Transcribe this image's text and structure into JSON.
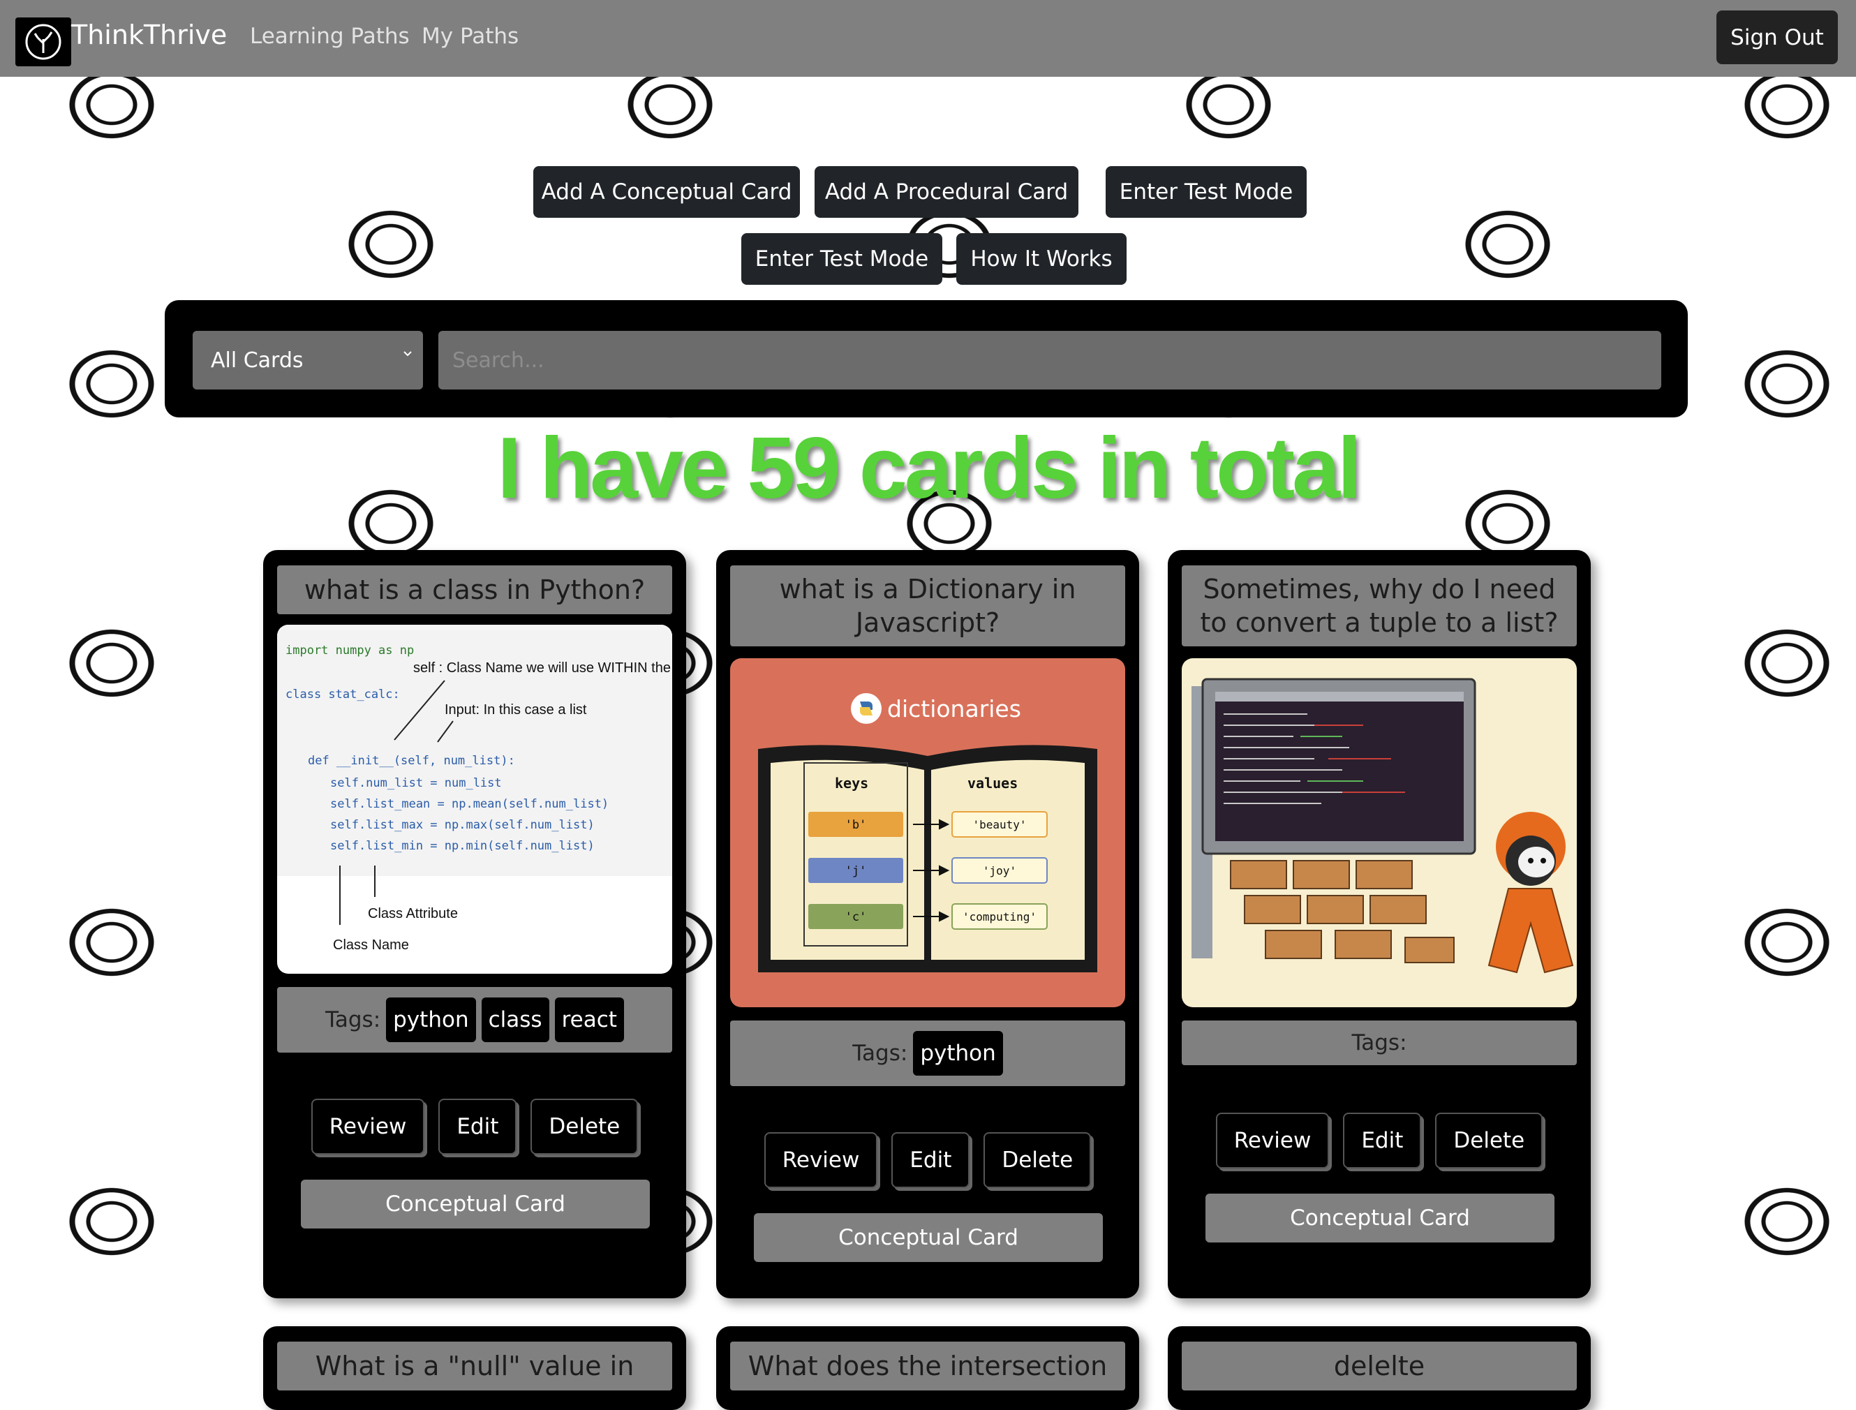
{
  "nav": {
    "brand": "ThinkThrive",
    "links": [
      "Learning Paths",
      "My Paths"
    ],
    "sign_out": "Sign Out"
  },
  "toolbar": {
    "buttons": [
      "Add A Conceptual Card",
      "Add A Procedural Card",
      "Enter Test Mode",
      "Enter Test Mode",
      "How It Works"
    ]
  },
  "filter": {
    "selected": "All Cards",
    "search_placeholder": "Search..."
  },
  "summary": "I have 59 cards in total",
  "cards": [
    {
      "title": "what is a class in Python?",
      "tags_label": "Tags:",
      "tags": [
        "python",
        "class",
        "react"
      ],
      "actions": [
        "Review",
        "Edit",
        "Delete"
      ],
      "type": "Conceptual Card",
      "image": {
        "lines": [
          "import numpy as np",
          "class stat_calc:",
          "def __init__(self, num_list):",
          "self.num_list = num_list",
          "self.list_mean = np.mean(self.num_list)",
          "self.list_max = np.max(self.num_list)",
          "self.list_min = np.min(self.num_list)"
        ],
        "notes": [
          "self : Class Name we will use WITHIN the Class",
          "Input: In this case a list",
          "Class Attribute",
          "Class Name"
        ]
      }
    },
    {
      "title": "what is a Dictionary in Javascript?",
      "tags_label": "Tags:",
      "tags": [
        "python"
      ],
      "actions": [
        "Review",
        "Edit",
        "Delete"
      ],
      "type": "Conceptual Card",
      "image": {
        "heading": "dictionaries",
        "keys_label": "keys",
        "values_label": "values",
        "keys": [
          "'b'",
          "'j'",
          "'c'"
        ],
        "values": [
          "'beauty'",
          "'joy'",
          "'computing'"
        ]
      }
    },
    {
      "title": "Sometimes, why do I need to convert a tuple to a list?",
      "tags_label": "Tags:",
      "tags": [],
      "actions": [
        "Review",
        "Edit",
        "Delete"
      ],
      "type": "Conceptual Card"
    },
    {
      "title": "What is a \"null\" value in"
    },
    {
      "title": "What does the intersection"
    },
    {
      "title": "delelte"
    }
  ]
}
